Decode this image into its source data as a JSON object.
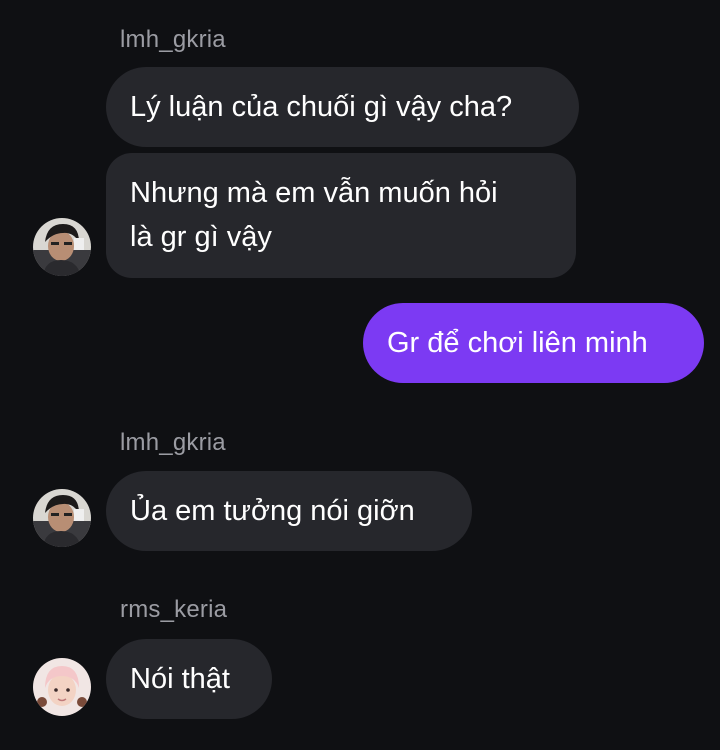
{
  "messages": [
    {
      "sender": "lmh_gkria",
      "text": "Lý luận của chuối gì vậy cha?"
    },
    {
      "text_lines": [
        "Nhưng mà em vẫn muốn hỏi",
        "là gr gì vậy"
      ]
    },
    {
      "text": "Gr để chơi liên minh",
      "outgoing": true
    },
    {
      "sender": "lmh_gkria",
      "text": "Ủa em tưởng nói giỡn"
    },
    {
      "sender": "rms_keria",
      "text": "Nói thật"
    }
  ],
  "avatars": {
    "lmh_gkria": "avatar-dark-hair-icon",
    "rms_keria": "avatar-light-hair-icon"
  },
  "colors": {
    "background": "#0f1013",
    "incoming_bubble": "#26272c",
    "outgoing_bubble": "#7c3af3",
    "sender_text": "#9b9ca3"
  }
}
